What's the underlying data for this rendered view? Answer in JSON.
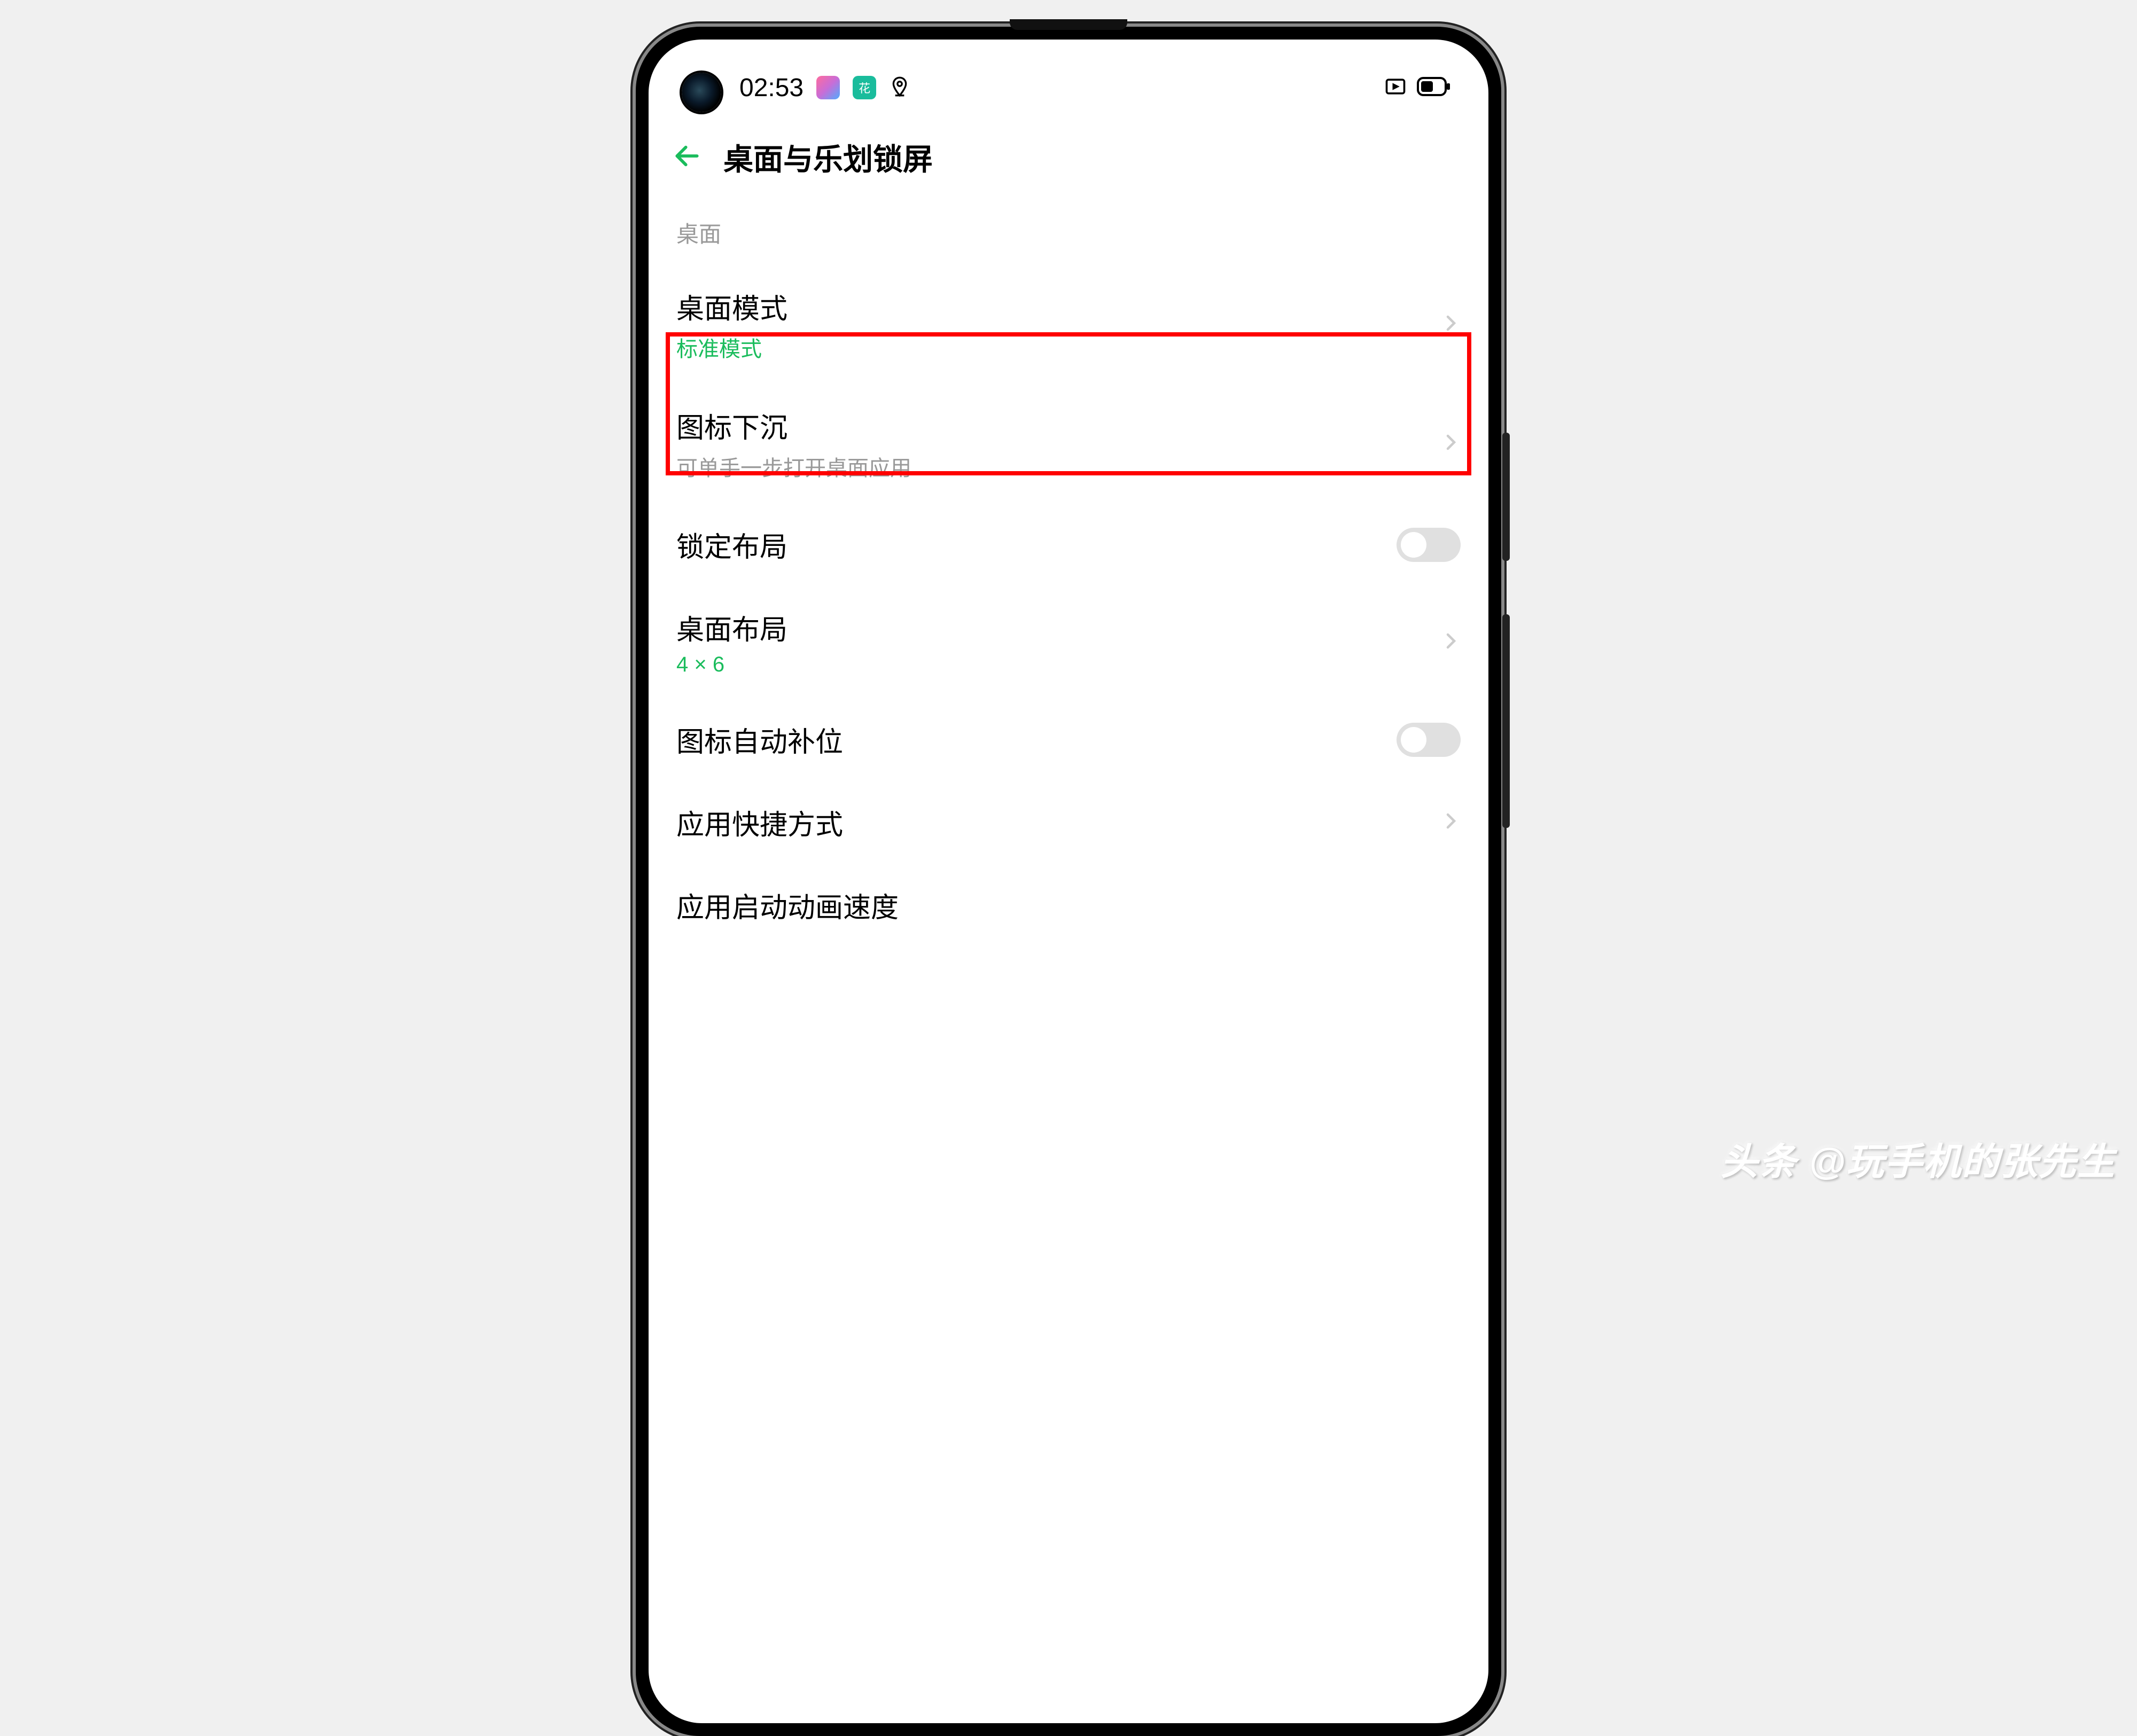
{
  "status": {
    "time": "02:53",
    "app_icon_2_text": "花"
  },
  "header": {
    "title": "桌面与乐划锁屏"
  },
  "section": {
    "label": "桌面"
  },
  "items": {
    "desktop_mode": {
      "title": "桌面模式",
      "subtitle": "标准模式"
    },
    "icon_sink": {
      "title": "图标下沉",
      "subtitle": "可单手一步打开桌面应用"
    },
    "lock_layout": {
      "title": "锁定布局",
      "toggle": false
    },
    "desktop_layout": {
      "title": "桌面布局",
      "subtitle": "4 × 6"
    },
    "icon_autofill": {
      "title": "图标自动补位",
      "toggle": false
    },
    "app_shortcut": {
      "title": "应用快捷方式"
    },
    "app_anim_speed": {
      "title": "应用启动动画速度"
    }
  },
  "watermark": "头条 @玩手机的张先生",
  "colors": {
    "accent": "#1abc5c",
    "highlight": "#ff0000"
  }
}
